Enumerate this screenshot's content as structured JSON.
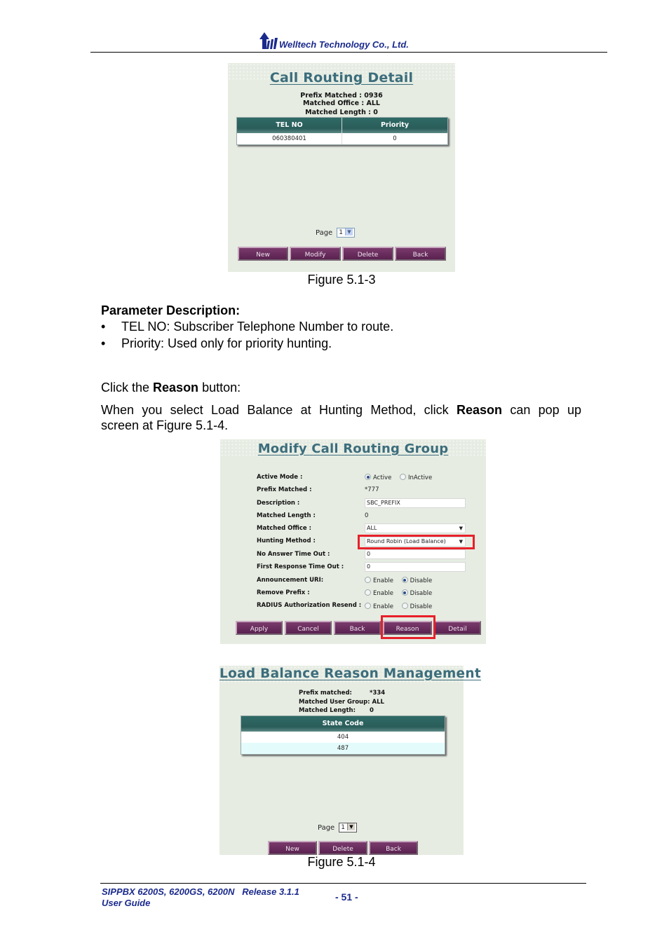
{
  "header": {
    "company": "Welltech Technology Co., Ltd.",
    "logo_icon": "welltech-logo-icon"
  },
  "figure1": {
    "title": "Call Routing Detail",
    "info": [
      "Prefix Matched : 0936",
      "Matched Office : ALL",
      "Matched Length : 0"
    ],
    "table": {
      "headers": [
        "TEL NO",
        "Priority"
      ],
      "rows": [
        [
          "060380401",
          "0"
        ]
      ]
    },
    "page_label": "Page",
    "page_value": "1",
    "buttons": [
      "New",
      "Modify",
      "Delete",
      "Back"
    ],
    "caption": "Figure 5.1-3"
  },
  "params": {
    "heading": "Parameter Description:",
    "bullets": [
      "TEL NO: Subscriber Telephone Number to route.",
      "Priority: Used only for priority hunting."
    ]
  },
  "click_line": {
    "pre": "Click the ",
    "bold": "Reason",
    "post": " button:"
  },
  "when_line": {
    "pre": "When you select Load Balance at Hunting Method, click ",
    "bold": "Reason",
    "post": " can pop up",
    "line2": "screen at Figure 5.1-4."
  },
  "figure2": {
    "title": "Modify Call Routing Group",
    "fields": [
      {
        "label": "Active Mode :",
        "type": "radio",
        "options": [
          "Active",
          "InActive"
        ],
        "selected": "Active"
      },
      {
        "label": "Prefix Matched :",
        "type": "text",
        "value": "*777"
      },
      {
        "label": "Description :",
        "type": "input",
        "value": "SBC_PREFIX"
      },
      {
        "label": "Matched Length :",
        "type": "text",
        "value": "0"
      },
      {
        "label": "Matched Office :",
        "type": "select",
        "value": "ALL"
      },
      {
        "label": "Hunting Method :",
        "type": "select",
        "value": "Round Robin (Load Balance)",
        "highlighted": true
      },
      {
        "label": "No Answer Time Out :",
        "type": "input",
        "value": "0"
      },
      {
        "label": "First Response Time Out :",
        "type": "input",
        "value": "0"
      },
      {
        "label": "Announcement URI:",
        "type": "radio",
        "options": [
          "Enable",
          "Disable"
        ],
        "selected": "Disable"
      },
      {
        "label": "Remove Prefix :",
        "type": "radio",
        "options": [
          "Enable",
          "Disable"
        ],
        "selected": "Disable"
      },
      {
        "label": "RADIUS Authorization Resend :",
        "type": "radio",
        "options": [
          "Enable",
          "Disable"
        ],
        "selected": ""
      }
    ],
    "buttons": [
      "Apply",
      "Cancel",
      "Back",
      "Reason",
      "Detail"
    ],
    "highlight_color": "#e8202a"
  },
  "figure3": {
    "title": "Load Balance Reason Management",
    "info": [
      {
        "label": "Prefix matched:",
        "value": "*334"
      },
      {
        "label": "Matched User Group:",
        "value": "ALL"
      },
      {
        "label": "Matched Length:",
        "value": "0"
      }
    ],
    "table": {
      "headers": [
        "State Code"
      ],
      "rows": [
        [
          "404"
        ],
        [
          "487"
        ]
      ]
    },
    "page_label": "Page",
    "page_value": "1",
    "buttons": [
      "New",
      "Delete",
      "Back"
    ],
    "caption": "Figure 5.1-4"
  },
  "footer": {
    "product": "SIPPBX 6200S, 6200GS, 6200N",
    "release": "Release 3.1.1",
    "guide": "User Guide",
    "page": "- 51 -"
  },
  "colors": {
    "panel_bg": "#e6ece2",
    "title_color": "#3c6d7c",
    "table_header": "#2f6a66",
    "button_bg": "#6a2c5e",
    "brand_text": "#1a2a8c"
  }
}
